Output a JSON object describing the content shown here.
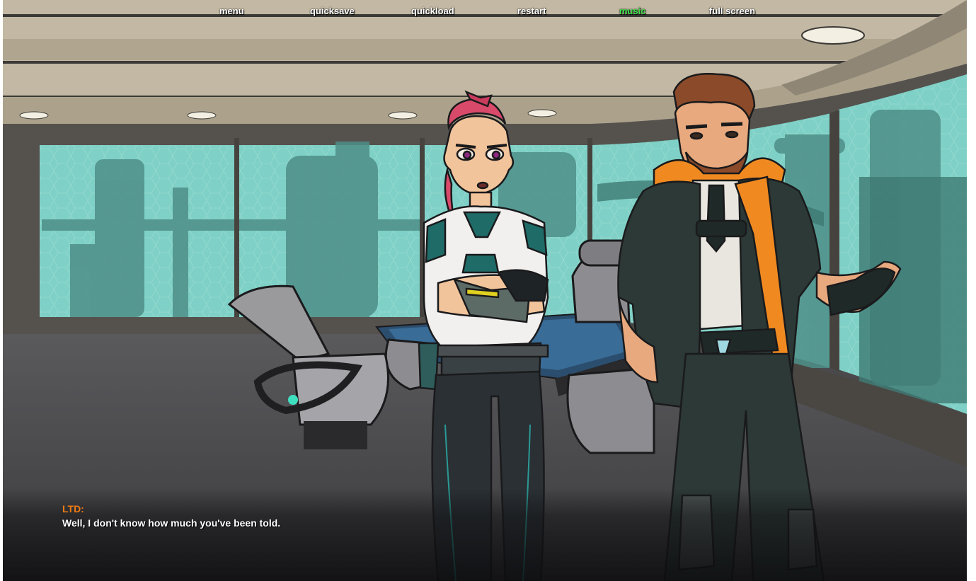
{
  "quick_menu": {
    "items": [
      {
        "label": "menu",
        "active": false
      },
      {
        "label": "quicksave",
        "active": false
      },
      {
        "label": "quickload",
        "active": false
      },
      {
        "label": "restart",
        "active": false
      },
      {
        "label": "music",
        "active": true
      },
      {
        "label": "full screen",
        "active": false
      }
    ],
    "active_color": "#3fe04a",
    "text_color": "#ffffff"
  },
  "dialogue": {
    "speaker": "LTD:",
    "text": "Well, I don't know how much you've been told.",
    "speaker_color": "#f07b14"
  },
  "scene": {
    "location": "spaceship-bridge",
    "characters": [
      "pink-mohawk-woman",
      "bearded-man-orange-collar"
    ],
    "window_tint": "#7fd0c6"
  }
}
